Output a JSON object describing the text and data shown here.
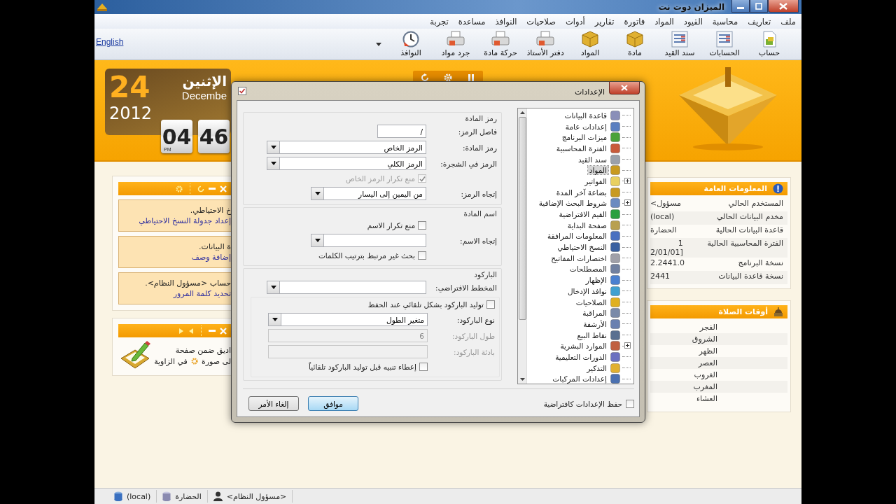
{
  "window": {
    "title": "الميزان دوت نت"
  },
  "menu": [
    "ملف",
    "تعاريف",
    "محاسبة",
    "القيود",
    "المواد",
    "فاتورة",
    "تقارير",
    "أدوات",
    "صلاحيات",
    "النوافذ",
    "مساعدة",
    "تجربة"
  ],
  "toolbar": {
    "items": [
      "حساب",
      "الحسابات",
      "سند القيد",
      "مادة",
      "المواد",
      "دفتر الأستاذ",
      "حركة مادة",
      "جرد مواد",
      "النوافذ"
    ],
    "language_link": "English"
  },
  "clock": {
    "day": "24",
    "weekday": "الإثنين",
    "month": "Decembe",
    "year": "2012",
    "hour": "04",
    "minute": "46",
    "period": "PM"
  },
  "tasks_panel": {
    "notices": [
      {
        "text": "خ الاحتياطي.",
        "link": "إعداد جدولة النسخ الاحتياطي"
      },
      {
        "text": "ة البيانات.",
        "link": "إضافة وصف"
      },
      {
        "text": "حساب <مسؤول النظام>.",
        "link": "تحديد كلمة المرور"
      }
    ]
  },
  "tips_panel": {
    "line_1": "اديق ضمن صفحة",
    "line_2_start": "لى صورة",
    "line_2_end": "في الزاوية"
  },
  "info_panel": {
    "title": "المعلومات العامة",
    "rows": [
      {
        "label": "المستخدم الحالي",
        "value": "<مسؤول"
      },
      {
        "label": "مخدم البيانات الحالي",
        "value": "(local)"
      },
      {
        "label": "قاعدة البيانات الحالية",
        "value": "الحضارة"
      },
      {
        "label": "الفترة المحاسبية الحالية",
        "value": "1",
        "value_line_2": "2/01/01]"
      },
      {
        "label": "نسخة البرنامج",
        "value": "2.2441.0"
      },
      {
        "label": "نسخة قاعدة البيانات",
        "value": "2441"
      }
    ]
  },
  "prayer_panel": {
    "title": "أوقات الصلاة",
    "rows": [
      "الفجر",
      "الشروق",
      "الظهر",
      "العصر",
      "الغروب",
      "المغرب",
      "العشاء"
    ]
  },
  "dialog": {
    "title": "الإعدادات",
    "tree": [
      {
        "label": "قاعدة البيانات",
        "expandable": false,
        "selected": false
      },
      {
        "label": "إعدادات عامة",
        "expandable": false,
        "selected": false
      },
      {
        "label": "ميزات البرنامج",
        "expandable": false,
        "selected": false
      },
      {
        "label": "الفترة المحاسبية",
        "expandable": false,
        "selected": false
      },
      {
        "label": "سند القيد",
        "expandable": false,
        "selected": false
      },
      {
        "label": "المواد",
        "expandable": false,
        "selected": true
      },
      {
        "label": "الفواتير",
        "expandable": true,
        "selected": false
      },
      {
        "label": "بضاعة آخر المدة",
        "expandable": false,
        "selected": false
      },
      {
        "label": "شروط البحث الإضافية",
        "expandable": true,
        "selected": false
      },
      {
        "label": "القيم الافتراضية",
        "expandable": false,
        "selected": false
      },
      {
        "label": "صفحة البداية",
        "expandable": false,
        "selected": false
      },
      {
        "label": "المعلومات المرافقة",
        "expandable": false,
        "selected": false
      },
      {
        "label": "النسخ الاحتياطي",
        "expandable": false,
        "selected": false
      },
      {
        "label": "اختصارات المفاتيح",
        "expandable": false,
        "selected": false
      },
      {
        "label": "المصطلحات",
        "expandable": false,
        "selected": false
      },
      {
        "label": "الإظهار",
        "expandable": false,
        "selected": false
      },
      {
        "label": "نوافذ الإدخال",
        "expandable": false,
        "selected": false
      },
      {
        "label": "الصلاحيات",
        "expandable": false,
        "selected": false
      },
      {
        "label": "المراقبة",
        "expandable": false,
        "selected": false
      },
      {
        "label": "الأرشفة",
        "expandable": false,
        "selected": false
      },
      {
        "label": "نقاط البيع",
        "expandable": false,
        "selected": false
      },
      {
        "label": "الموارد البشرية",
        "expandable": true,
        "selected": false
      },
      {
        "label": "الدورات التعليمية",
        "expandable": false,
        "selected": false
      },
      {
        "label": "التذكير",
        "expandable": false,
        "selected": false
      },
      {
        "label": "إعدادات المركبات",
        "expandable": false,
        "selected": false
      }
    ],
    "groups": [
      {
        "title": "رمز المادة",
        "rows": [
          {
            "kind": "input",
            "label": "فاصل الرمز:",
            "value": "/"
          },
          {
            "kind": "select",
            "label": "رمز المادة:",
            "value": "الرمز الخاص"
          },
          {
            "kind": "select",
            "label": "الرمز في الشجرة:",
            "value": "الرمز الكلي"
          },
          {
            "kind": "check",
            "label": "منع تكرار الرمز الخاص",
            "checked": true,
            "disabled": true
          },
          {
            "kind": "narrowselect",
            "label": "إتجاه الرمز:",
            "value": "من اليمين إلى اليسار"
          }
        ]
      },
      {
        "title": "اسم المادة",
        "rows": [
          {
            "kind": "check",
            "label": "منع تكرار الاسم",
            "checked": false,
            "disabled": false
          },
          {
            "kind": "narrowselect",
            "label": "إتجاه الاسم:"
          },
          {
            "kind": "check",
            "label": "بحث غير مرتبط بترتيب الكلمات",
            "checked": false,
            "disabled": false
          }
        ]
      },
      {
        "title": "الباركود",
        "rows": [
          {
            "kind": "select",
            "label": "المخطط الافتراضي:"
          }
        ],
        "subgroup": [
          {
            "kind": "fullcheck",
            "label": "توليد الباركود بشكل تلقائي عند الحفظ",
            "checked": false,
            "disabled": false
          },
          {
            "kind": "select",
            "label": "نوع الباركود:",
            "value": "متغير الطول"
          },
          {
            "kind": "readonly",
            "label": "طول الباركود:",
            "value": "6"
          },
          {
            "kind": "readonly",
            "label": "بادئة الباركود:"
          },
          {
            "kind": "check",
            "label": "إعطاء تنبيه قبل توليد الباركود تلقائياً",
            "checked": false,
            "disabled": false
          }
        ]
      }
    ],
    "save_default": {
      "label": "حفظ الإعدادات كافتراضية",
      "checked": false
    },
    "buttons": [
      {
        "label": "موافق",
        "kind": "default"
      },
      {
        "label": "إلغاء الأمر",
        "kind": "normal"
      }
    ]
  },
  "status_bar": {
    "server": "(local)",
    "database": "الحضارة",
    "user": "<مسؤول النظام>"
  }
}
